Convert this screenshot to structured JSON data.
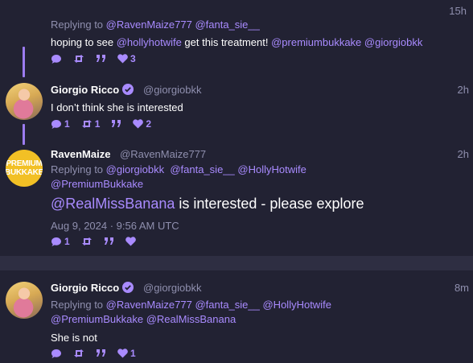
{
  "colors": {
    "background": "#222233",
    "accent": "#a98bff",
    "muted": "#8f8fae"
  },
  "post1": {
    "time": "15h",
    "replying_prefix": "Replying to ",
    "replying_to": [
      "@RavenMaize777",
      "@fanta_sie__"
    ],
    "text_before": "hoping to see ",
    "text_mention1": "@hollyhotwife",
    "text_middle": " get this treatment! ",
    "text_mention2": "@premiumbukkake",
    "text_mention3": "@giorgiobkk",
    "likes": "3"
  },
  "post2": {
    "name": "Giorgio Ricco",
    "handle": "@giorgiobkk",
    "time": "2h",
    "text": "I don’t think she is interested",
    "replies": "1",
    "retweets": "1",
    "likes": "2"
  },
  "post3": {
    "name": "RavenMaize",
    "handle": "@RavenMaize777",
    "time": "2h",
    "avatar_text": [
      "PREMIUM",
      "BUKKAKE"
    ],
    "replying_prefix": "Replying to ",
    "replying_to": [
      "@giorgiobkk",
      "@fanta_sie__",
      "@HollyHotwife",
      "@PremiumBukkake"
    ],
    "text_mention": "@RealMissBanana",
    "text_rest": " is interested - please explore",
    "date": "Aug 9, 2024 · 9:56 AM UTC",
    "replies": "1"
  },
  "post4": {
    "name": "Giorgio Ricco",
    "handle": "@giorgiobkk",
    "time": "8m",
    "replying_prefix": "Replying to ",
    "replying_to": [
      "@RavenMaize777",
      "@fanta_sie__",
      "@HollyHotwife",
      "@PremiumBukkake",
      "@RealMissBanana"
    ],
    "text": "She is not",
    "likes": "1"
  },
  "icons": {
    "reply": "reply-icon",
    "retweet": "retweet-icon",
    "quote": "quote-icon",
    "like": "heart-icon",
    "verified": "verified-badge-icon"
  }
}
